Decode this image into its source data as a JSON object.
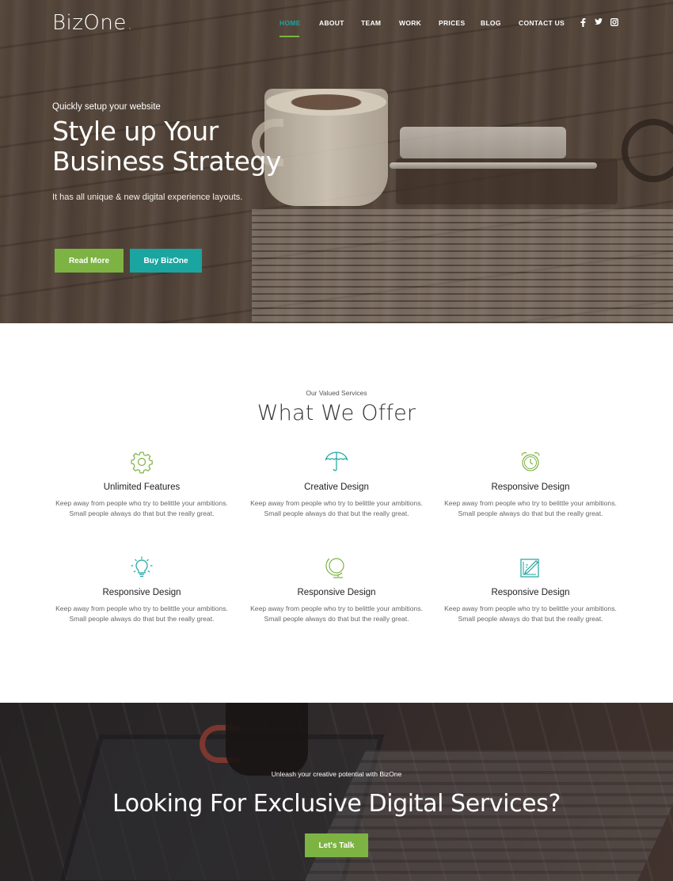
{
  "brand": {
    "name": "BizOne",
    "dot": "."
  },
  "nav": {
    "items": [
      {
        "label": "HOME",
        "active": true
      },
      {
        "label": "ABOUT"
      },
      {
        "label": "TEAM"
      },
      {
        "label": "WORK"
      },
      {
        "label": "PRICES"
      },
      {
        "label": "BLOG"
      },
      {
        "label": "CONTACT US"
      }
    ],
    "social": {
      "facebook": "f",
      "twitter": "t",
      "instagram": "i"
    }
  },
  "hero": {
    "kicker": "Quickly setup your website",
    "title": "Style up Your Business Strategy",
    "subtitle": "It has all unique & new digital experience layouts.",
    "primary_button": "Read More",
    "secondary_button": "Buy BizOne"
  },
  "services": {
    "kicker": "Our Valued Services",
    "title": "What We Offer",
    "items": [
      {
        "icon": "gear-icon",
        "title": "Unlimited Features",
        "text": "Keep away from people who try to belittle your ambitions. Small people always do that but the really great."
      },
      {
        "icon": "umbrella-icon",
        "title": "Creative Design",
        "text": "Keep away from people who try to belittle your ambitions. Small people always do that but the really great."
      },
      {
        "icon": "alarm-clock-icon",
        "title": "Responsive Design",
        "text": "Keep away from people who try to belittle your ambitions. Small people always do that but the really great."
      },
      {
        "icon": "lightbulb-icon",
        "title": "Responsive Design",
        "text": "Keep away from people who try to belittle your ambitions. Small people always do that but the really great."
      },
      {
        "icon": "globe-icon",
        "title": "Responsive Design",
        "text": "Keep away from people who try to belittle your ambitions. Small people always do that but the really great."
      },
      {
        "icon": "design-board-icon",
        "title": "Responsive Design",
        "text": "Keep away from people who try to belittle your ambitions. Small people always do that but the really great."
      }
    ]
  },
  "cta": {
    "kicker": "Unleash your creative potential with BizOne",
    "title": "Looking For Exclusive Digital Services?",
    "button": "Let's Talk"
  },
  "colors": {
    "green": "#7cb342",
    "teal": "#1aa5a0"
  }
}
